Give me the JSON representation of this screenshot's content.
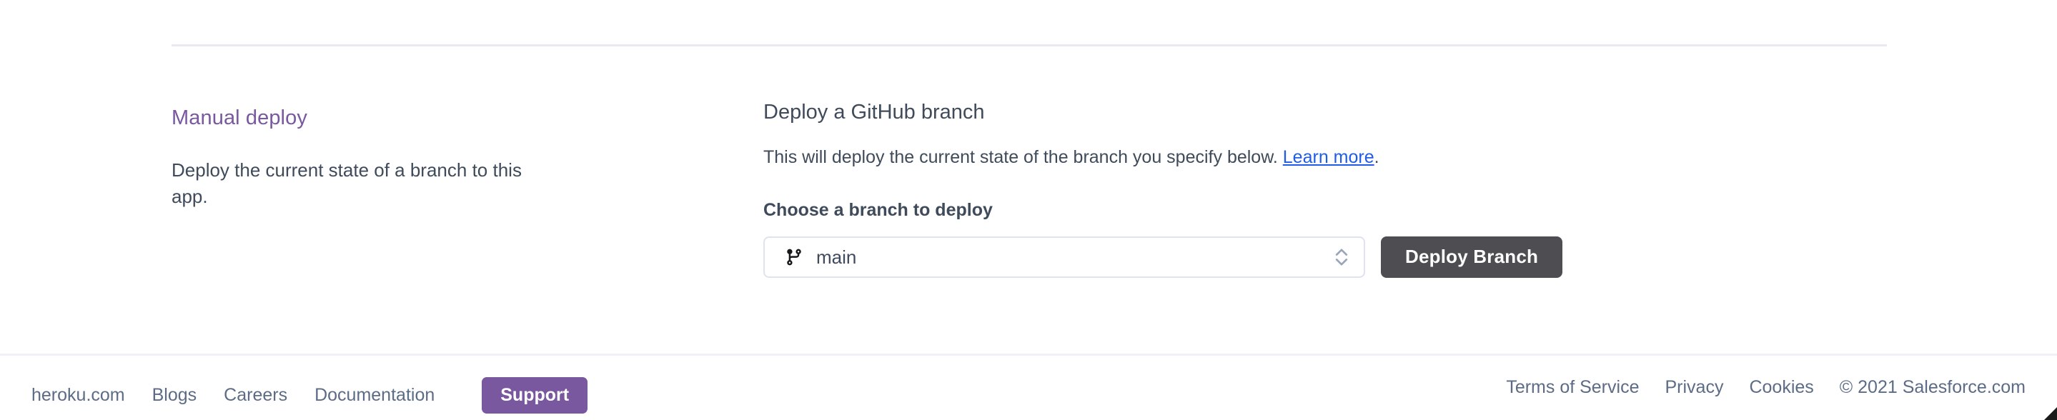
{
  "top_divider": true,
  "manual_deploy": {
    "title": "Manual deploy",
    "description": "Deploy the current state of a branch to this app."
  },
  "deploy_panel": {
    "title": "Deploy a GitHub branch",
    "description_before_link": "This will deploy the current state of the branch you specify below. ",
    "learn_more_label": "Learn more",
    "description_after_link": ".",
    "field_label": "Choose a branch to deploy",
    "branch_icon": "git-branch-icon",
    "selected_branch": "main",
    "select_chevron_icon": "chevron-up-down-icon",
    "deploy_button_label": "Deploy Branch",
    "deploy_button_color": "#4d4d52",
    "link_color": "#1f5ce8"
  },
  "footer": {
    "left_links": [
      {
        "label": "heroku.com"
      },
      {
        "label": "Blogs"
      },
      {
        "label": "Careers"
      },
      {
        "label": "Documentation"
      }
    ],
    "support_button_label": "Support",
    "support_button_color": "#79589f",
    "right_links": [
      {
        "label": "Terms of Service"
      },
      {
        "label": "Privacy"
      },
      {
        "label": "Cookies"
      }
    ],
    "copyright": "© 2021 Salesforce.com"
  },
  "accent_purple": "#79589f",
  "text_color": "#3f4b5b"
}
